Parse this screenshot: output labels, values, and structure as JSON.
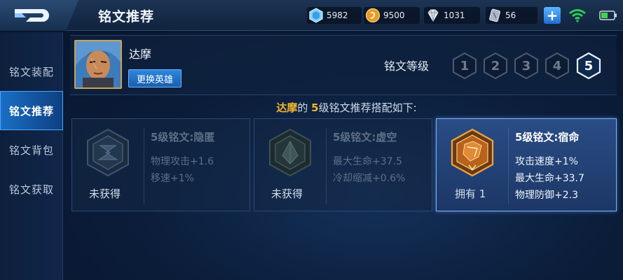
{
  "header": {
    "title": "铭文推荐",
    "currencies": [
      {
        "icon": "diamond-icon",
        "value": "5982"
      },
      {
        "icon": "gold-coin-icon",
        "value": "9500"
      },
      {
        "icon": "gem-icon",
        "value": "1031"
      },
      {
        "icon": "rune-shard-icon",
        "value": "56"
      }
    ],
    "colors": {
      "accent": "#1a6fc6",
      "highlight": "#f3b52d",
      "wifi": "#2ecc55",
      "battery": "#3fd34f"
    }
  },
  "sidebar": {
    "items": [
      {
        "label": "铭文装配",
        "active": false
      },
      {
        "label": "铭文推荐",
        "active": true
      },
      {
        "label": "铭文背包",
        "active": false
      },
      {
        "label": "铭文获取",
        "active": false
      }
    ]
  },
  "hero": {
    "name": "达摩",
    "change_button": "更换英雄"
  },
  "level": {
    "label": "铭文等级",
    "options": [
      "1",
      "2",
      "3",
      "4",
      "5"
    ],
    "selected": "5"
  },
  "recommendation": {
    "hero": "达摩",
    "part1": "的 ",
    "level": "5",
    "part2": "级铭文推荐搭配如下:"
  },
  "runes": [
    {
      "title": "5级铭文:隐匿",
      "attrs": [
        "物理攻击+1.6",
        "移速+1%"
      ],
      "status": "未获得",
      "owned": false,
      "color": "dark-gray"
    },
    {
      "title": "5级铭文:虚空",
      "attrs": [
        "最大生命+37.5",
        "冷却缩减+0.6%"
      ],
      "status": "未获得",
      "owned": false,
      "color": "dark-gray"
    },
    {
      "title": "5级铭文:宿命",
      "attrs": [
        "攻击速度+1%",
        "最大生命+33.7",
        "物理防御+2.3"
      ],
      "status": "拥有 1",
      "owned": true,
      "color": "orange"
    }
  ]
}
